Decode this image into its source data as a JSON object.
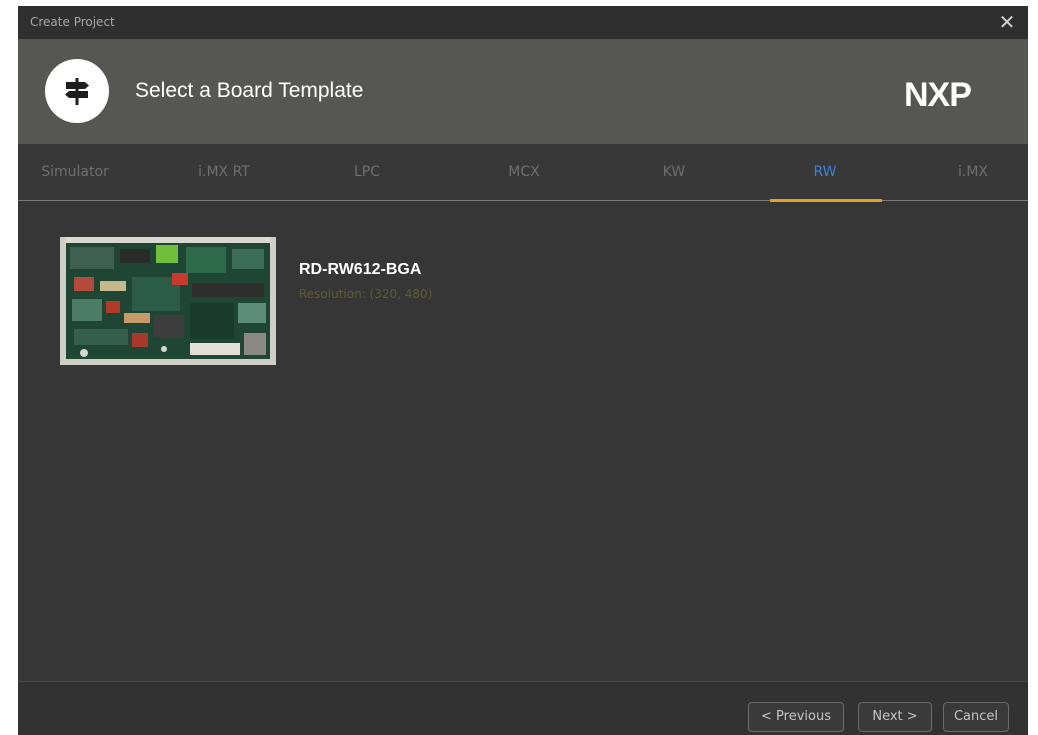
{
  "window": {
    "title": "Create Project",
    "close_glyph": "✕"
  },
  "header": {
    "heading": "Select a Board Template",
    "logo_icon": "signpost-icon",
    "brand": "NXP"
  },
  "tabs": [
    {
      "label": "Simulator",
      "active": false
    },
    {
      "label": "i.MX RT",
      "active": false
    },
    {
      "label": "LPC",
      "active": false
    },
    {
      "label": "MCX",
      "active": false
    },
    {
      "label": "KW",
      "active": false
    },
    {
      "label": "RW",
      "active": true
    },
    {
      "label": "i.MX",
      "active": false
    }
  ],
  "boards": [
    {
      "name": "RD-RW612-BGA",
      "subtitle": "Resolution: (320, 480)"
    }
  ],
  "footer": {
    "previous_label": "< Previous",
    "next_label": "Next >",
    "cancel_label": "Cancel"
  },
  "colors": {
    "accent_tab": "#3b82d6",
    "tab_underline": "#d9a521",
    "header_bg": "#565652",
    "body_bg": "#363636"
  }
}
